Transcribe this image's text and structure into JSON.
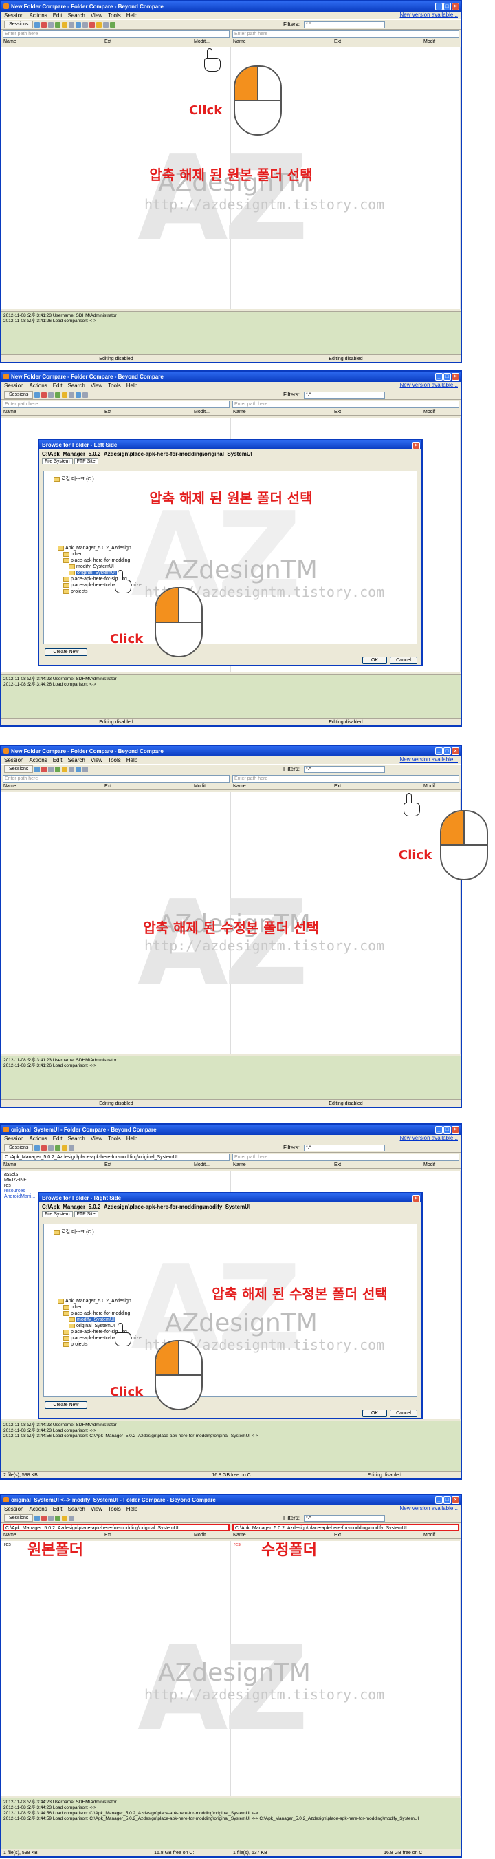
{
  "menu": [
    "Session",
    "Actions",
    "Edit",
    "Search",
    "View",
    "Tools",
    "Help"
  ],
  "new_version": "New version available...",
  "sessions_label": "Sessions",
  "filters_label": "Filters:",
  "filters_value": "*.*",
  "path_placeholder": "Enter path here",
  "columns": {
    "name": "Name",
    "ext": "Ext",
    "modified": "Modit...",
    "modified2": "Modif"
  },
  "click_label": "Click",
  "editing_disabled": "Editing disabled",
  "watermark": {
    "big": "AZ",
    "mid": "AZdesignTM",
    "url": "http://azdesigntm.tistory.com"
  },
  "icons": [
    "app-icon",
    "minimize-icon",
    "maximize-icon",
    "close-icon",
    "folder-browse-icon",
    "hand-cursor-icon",
    "mouse-icon",
    "folder-icon"
  ],
  "accent_color": "#e41e1e",
  "panels": [
    {
      "title": "New Folder Compare - Folder Compare - Beyond Compare",
      "caption": "압축 해제 된 원본 폴더 선택",
      "log": [
        "2012-11-08 오후 3:41:23  Username: SDHM\\Administrator",
        "2012-11-08 오후 3:41:26  Load comparison: <->"
      ]
    },
    {
      "title": "New Folder Compare - Folder Compare - Beyond Compare",
      "dialog_title": "Browse for Folder - Left Side",
      "dialog_path": "C:\\Apk_Manager_5.0.2_Azdesign\\place-apk-here-for-modding\\original_SystemUI",
      "tabs": [
        "File System",
        "FTP Site"
      ],
      "tree": [
        "로컬 디스크 (C:)",
        "Apk_Manager_5.0.2_Azdesign",
        "other",
        "place-apk-here-for-modding",
        "modify_SystemUI",
        "original_SystemUI",
        "place-apk-here-for-signing",
        "place-apk-here-to-batch-optimize",
        "projects"
      ],
      "create_new": "Create New",
      "ok": "OK",
      "cancel": "Cancel",
      "caption": "압축 해제 된 원본 폴더 선택",
      "log": [
        "2012-11-08 오후 3:44:23  Username: SDHM\\Administrator",
        "2012-11-08 오후 3:44:26  Load comparison: <->"
      ]
    },
    {
      "title": "New Folder Compare - Folder Compare - Beyond Compare",
      "caption": "압축 해제 된 수정본 폴더 선택",
      "log": [
        "2012-11-08 오후 3:41:23  Username: SDHM\\Administrator",
        "2012-11-08 오후 3:41:26  Load comparison: <->"
      ]
    },
    {
      "title": "original_SystemUI - Folder Compare - Beyond Compare",
      "left_path": "C:\\Apk_Manager_5.0.2_Azdesign\\place-apk-here-for-modding\\original_SystemUI",
      "left_files": [
        "assets",
        "META-INF",
        "res",
        "resources",
        "AndroidMani..."
      ],
      "dialog_title": "Browse for Folder - Right Side",
      "dialog_path": "C:\\Apk_Manager_5.0.2_Azdesign\\place-apk-here-for-modding\\modify_SystemUI",
      "tabs": [
        "File System",
        "FTP Site"
      ],
      "tree": [
        "로컬 디스크 (C:)",
        "Apk_Manager_5.0.2_Azdesign",
        "other",
        "place-apk-here-for-modding",
        "modify_SystemUI",
        "original_SystemUI",
        "place-apk-here-for-signing",
        "place-apk-here-to-batch-optimize",
        "projects"
      ],
      "create_new": "Create New",
      "ok": "OK",
      "cancel": "Cancel",
      "caption": "압축 해제 된 수정본 폴더 선택",
      "log": [
        "2012-11-08 오후 3:44:23  Username: SDHM\\Administrator",
        "2012-11-08 오후 3:44:23  Load comparison: <->",
        "2012-11-08 오후 3:44:56  Load comparison: C:\\Apk_Manager_5.0.2_Azdesign\\place-apk-here-for-modding\\original_SystemUI <->"
      ],
      "status_left": "2 file(s), 598 KB",
      "status_mid": "16.8 GB free on C:"
    },
    {
      "title": "original_SystemUI <--> modify_SystemUI - Folder Compare - Beyond Compare",
      "left_path": "C:\\Apk_Manager_5.0.2_Azdesign\\place-apk-here-for-modding\\original_SystemUI",
      "right_path": "C:\\Apk_Manager_5.0.2_Azdesign\\place-apk-here-for-modding\\modify_SystemUI",
      "left_label": "원본폴더",
      "right_label": "수정폴더",
      "left_row": "res",
      "right_row": "res",
      "log": [
        "2012-11-08 오후 3:44:23  Username: SDHM\\Administrator",
        "2012-11-08 오후 3:44:23  Load comparison: <->",
        "2012-11-08 오후 3:44:56  Load comparison: C:\\Apk_Manager_5.0.2_Azdesign\\place-apk-here-for-modding\\original_SystemUI <->",
        "2012-11-08 오후 3:44:59  Load comparison: C:\\Apk_Manager_5.0.2_Azdesign\\place-apk-here-for-modding\\original_SystemUI <-> C:\\Apk_Manager_5.0.2_Azdesign\\place-apk-here-for-modding\\modify_SystemUI"
      ],
      "status_left": "1 file(s), 598 KB",
      "status_mid": "16.8 GB free on C:",
      "status_right": "1 file(s), 637 KB",
      "status_right_mid": "16.8 GB free on C:"
    }
  ]
}
